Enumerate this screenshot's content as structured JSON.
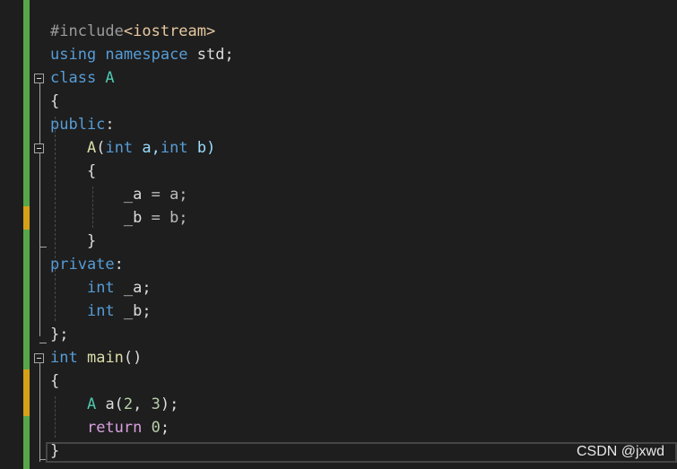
{
  "code": [
    [
      {
        "t": "#include",
        "c": "#9b9b9b"
      },
      {
        "t": "<iostream>",
        "c": "#e8c9a0"
      }
    ],
    [
      {
        "t": "using ",
        "c": "#569cd6"
      },
      {
        "t": "namespace ",
        "c": "#569cd6"
      },
      {
        "t": "std;",
        "c": "#dcdcdc"
      }
    ],
    [
      {
        "t": "class ",
        "c": "#569cd6"
      },
      {
        "t": "A",
        "c": "#4ec9b0"
      }
    ],
    [
      {
        "t": "{",
        "c": "#dcdcdc"
      }
    ],
    [
      {
        "t": "public",
        "c": "#569cd6"
      },
      {
        "t": ":",
        "c": "#dcdcdc"
      }
    ],
    [
      {
        "t": "    ",
        "c": "#dcdcdc"
      },
      {
        "t": "A",
        "c": "#dcdcaa"
      },
      {
        "t": "(",
        "c": "#dcdcdc"
      },
      {
        "t": "int",
        "c": "#569cd6"
      },
      {
        "t": " a,",
        "c": "#9cdcfe"
      },
      {
        "t": "int",
        "c": "#569cd6"
      },
      {
        "t": " b)",
        "c": "#9cdcfe"
      }
    ],
    [
      {
        "t": "    {",
        "c": "#dcdcdc"
      }
    ],
    [
      {
        "t": "        _a",
        "c": "#dcdcdc"
      },
      {
        "t": " = a;",
        "c": "#bcbcbc"
      }
    ],
    [
      {
        "t": "        _b",
        "c": "#dcdcdc"
      },
      {
        "t": " = b;",
        "c": "#bcbcbc"
      }
    ],
    [
      {
        "t": "    }",
        "c": "#dcdcdc"
      }
    ],
    [
      {
        "t": "private",
        "c": "#569cd6"
      },
      {
        "t": ":",
        "c": "#dcdcdc"
      }
    ],
    [
      {
        "t": "    ",
        "c": "#dcdcdc"
      },
      {
        "t": "int",
        "c": "#569cd6"
      },
      {
        "t": " _a;",
        "c": "#dcdcdc"
      }
    ],
    [
      {
        "t": "    ",
        "c": "#dcdcdc"
      },
      {
        "t": "int",
        "c": "#569cd6"
      },
      {
        "t": " _b;",
        "c": "#dcdcdc"
      }
    ],
    [
      {
        "t": "};",
        "c": "#dcdcdc"
      }
    ],
    [
      {
        "t": "int",
        "c": "#569cd6"
      },
      {
        "t": " ",
        "c": "#dcdcdc"
      },
      {
        "t": "main",
        "c": "#dcdcaa"
      },
      {
        "t": "()",
        "c": "#dcdcdc"
      }
    ],
    [
      {
        "t": "{",
        "c": "#dcdcdc"
      }
    ],
    [
      {
        "t": "    ",
        "c": "#dcdcdc"
      },
      {
        "t": "A",
        "c": "#4ec9b0"
      },
      {
        "t": " a(",
        "c": "#dcdcdc"
      },
      {
        "t": "2",
        "c": "#b5cea8"
      },
      {
        "t": ", ",
        "c": "#dcdcdc"
      },
      {
        "t": "3",
        "c": "#b5cea8"
      },
      {
        "t": ");",
        "c": "#dcdcdc"
      }
    ],
    [
      {
        "t": "    ",
        "c": "#dcdcdc"
      },
      {
        "t": "return",
        "c": "#d8a0df"
      },
      {
        "t": " ",
        "c": "#dcdcdc"
      },
      {
        "t": "0",
        "c": "#b5cea8"
      },
      {
        "t": ";",
        "c": "#dcdcdc"
      }
    ],
    [
      {
        "t": "}",
        "c": "#dcdcdc"
      }
    ]
  ],
  "change_markers": [
    {
      "from": 0,
      "to": 8,
      "color": "#57a64a"
    },
    {
      "from": 8,
      "to": 9,
      "color": "#d6a116"
    },
    {
      "from": 9,
      "to": 15,
      "color": "#57a64a"
    },
    {
      "from": 15,
      "to": 17,
      "color": "#d6a116"
    },
    {
      "from": 17,
      "to": 19,
      "color": "#57a64a"
    }
  ],
  "fold_markers": [
    2,
    5,
    14
  ],
  "watermark": "CSDN @jxwd"
}
